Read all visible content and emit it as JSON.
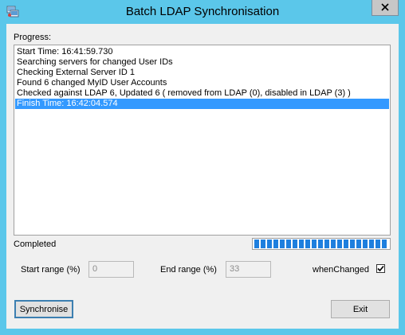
{
  "window": {
    "title": "Batch LDAP Synchronisation",
    "accent_color": "#5bc7ea",
    "icons": [
      "app-icon",
      "close-icon"
    ]
  },
  "progress_label": "Progress:",
  "log": {
    "lines": [
      "Start Time: 16:41:59.730",
      "Searching servers for changed User IDs",
      "Checking External Server ID 1",
      "Found 6 changed MyID User Accounts",
      "Checked against LDAP 6, Updated 6 ( removed from LDAP (0), disabled in LDAP (3) )",
      "Finish Time: 16:42:04.574"
    ],
    "selected_index": 5,
    "selection_color": "#3399ff"
  },
  "status": {
    "text": "Completed",
    "progress_fraction": 1.0,
    "progress_color": "#1e7fde"
  },
  "range": {
    "start_label": "Start range (%)",
    "start_value": "0",
    "end_label": "End range (%)",
    "end_value": "33",
    "when_changed_label": "whenChanged",
    "when_changed_checked": true
  },
  "buttons": {
    "synchronise": "Synchronise",
    "exit": "Exit"
  }
}
